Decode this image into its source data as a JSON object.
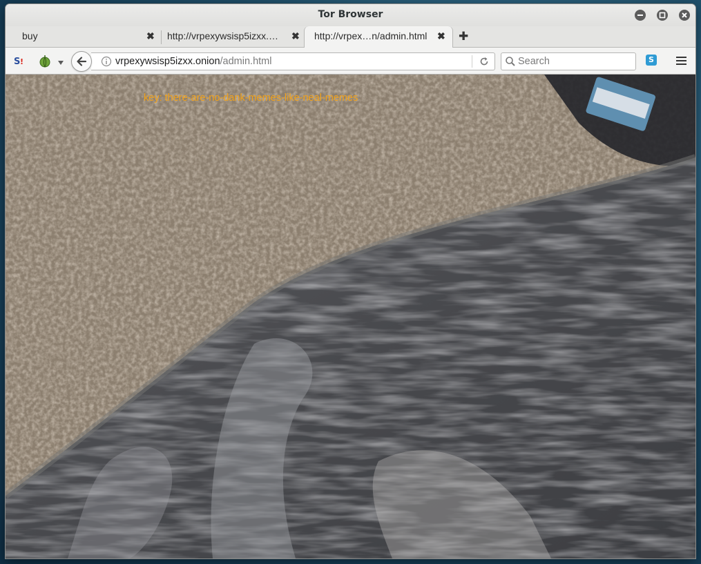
{
  "window": {
    "title": "Tor Browser"
  },
  "tabs": [
    {
      "label": "buy",
      "active": false
    },
    {
      "label": "http://vrpexywsisp5izxx.…",
      "active": false
    },
    {
      "label": "http://vrpex…n/admin.html",
      "active": true
    }
  ],
  "toolbar": {
    "url_host": "vrpexywsisp5izxx.onion",
    "url_path": "/admin.html",
    "search_placeholder": "Search"
  },
  "page": {
    "key_text": "key: there-are-no-dank-memes-like-neal-memes"
  },
  "colors": {
    "key_text": "#f2a21a",
    "tor_onion": "#6fa33a",
    "extension_badge": "#2f9bd4"
  }
}
